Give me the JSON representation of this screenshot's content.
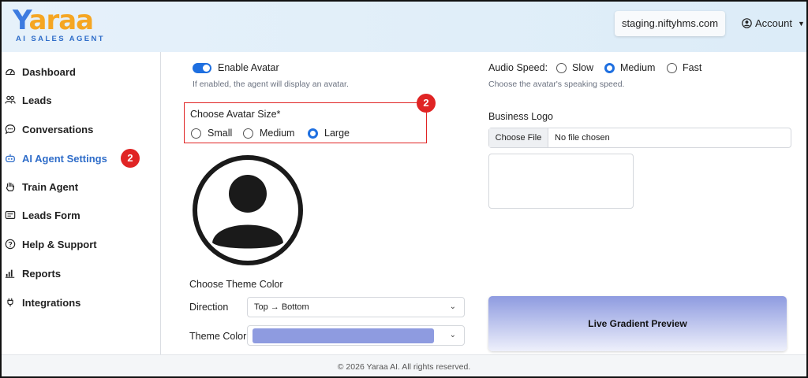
{
  "brand": {
    "logo_word_y": "Y",
    "logo_word_rest": "araa",
    "logo_sub": "AI SALES AGENT"
  },
  "header": {
    "domain": "staging.niftyhms.com",
    "account_label": "Account"
  },
  "sidebar": {
    "items": [
      {
        "label": "Dashboard",
        "icon": "dashboard-icon"
      },
      {
        "label": "Leads",
        "icon": "users-icon"
      },
      {
        "label": "Conversations",
        "icon": "chat-icon"
      },
      {
        "label": "AI Agent Settings",
        "icon": "robot-icon",
        "active": true
      },
      {
        "label": "Train Agent",
        "icon": "hand-icon"
      },
      {
        "label": "Leads Form",
        "icon": "form-icon"
      },
      {
        "label": "Help & Support",
        "icon": "help-icon"
      },
      {
        "label": "Reports",
        "icon": "bar-chart-icon"
      },
      {
        "label": "Integrations",
        "icon": "plug-icon"
      }
    ],
    "badge": "2"
  },
  "avatar": {
    "toggle_label": "Enable Avatar",
    "toggle_on": true,
    "help": "If enabled, the agent will display an avatar.",
    "size_label": "Choose Avatar Size*",
    "sizes": [
      "Small",
      "Medium",
      "Large"
    ],
    "selected_size": "Large",
    "callout_badge": "2"
  },
  "audio": {
    "label": "Audio Speed:",
    "options": [
      "Slow",
      "Medium",
      "Fast"
    ],
    "selected": "Medium",
    "help": "Choose the avatar's speaking speed."
  },
  "business_logo": {
    "label": "Business Logo",
    "button": "Choose File",
    "status": "No file chosen"
  },
  "theme": {
    "section_label": "Choose Theme Color",
    "direction_label": "Direction",
    "direction_value": "Top → Bottom",
    "color_label": "Theme Color",
    "color_value": "#8e9be0"
  },
  "preview": {
    "label": "Live Gradient Preview"
  },
  "footer": {
    "text": "© 2026 Yaraa AI. All rights reserved."
  },
  "colors": {
    "accent": "#1e6fe0",
    "badge": "#e02424",
    "logo_orange": "#f5a623"
  }
}
